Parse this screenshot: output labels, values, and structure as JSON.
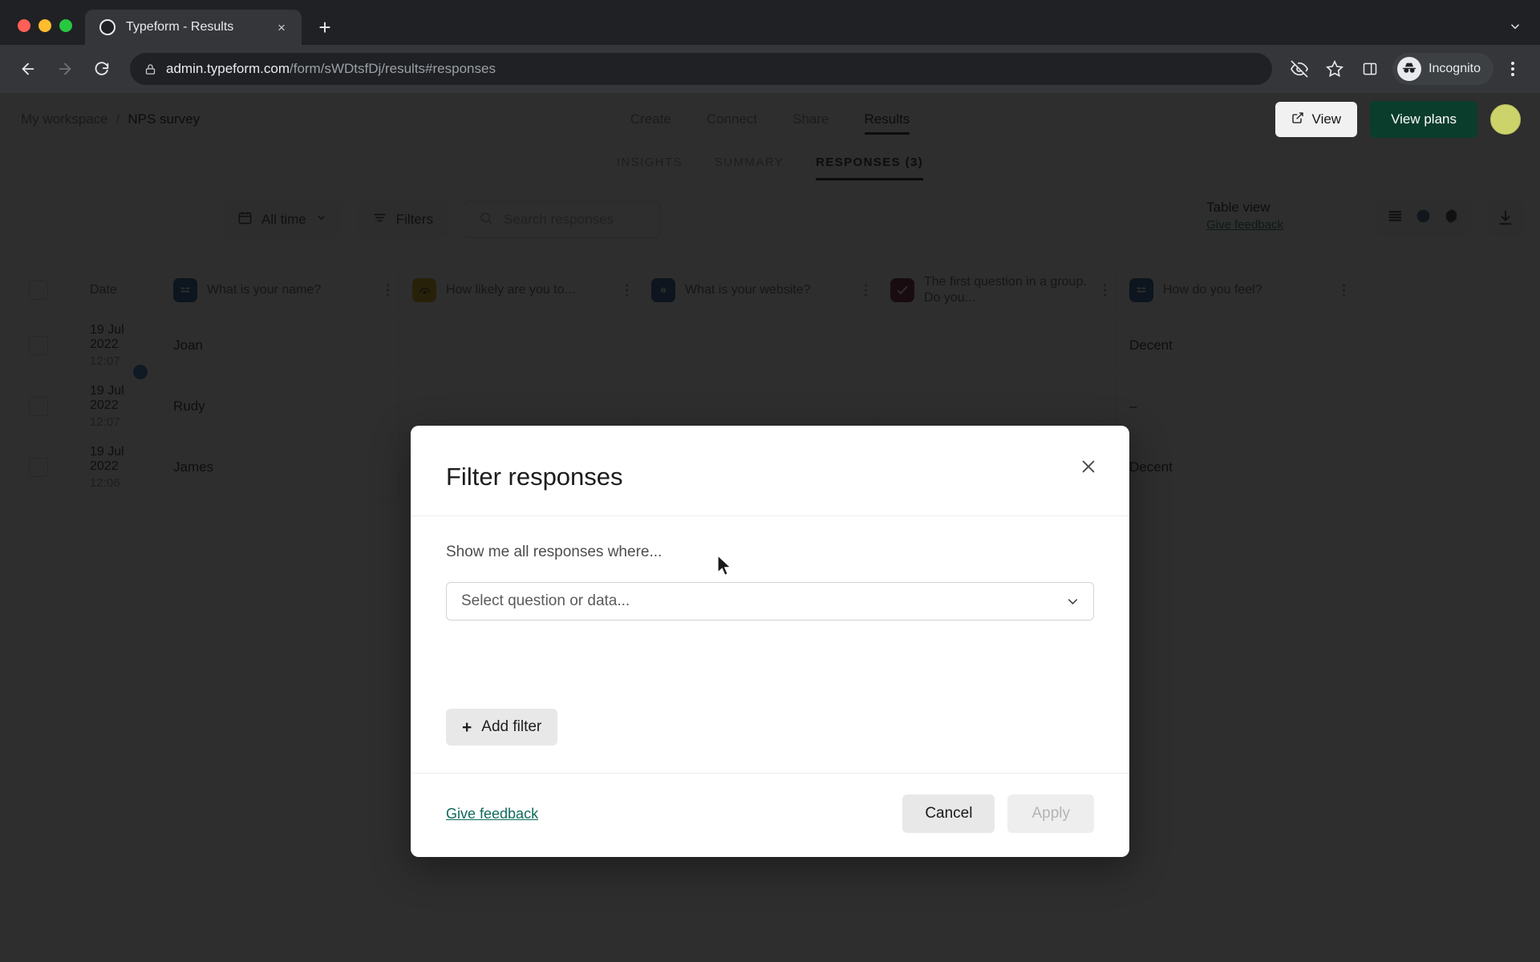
{
  "browser": {
    "tab": {
      "title": "Typeform - Results",
      "favicon": "circle-favicon",
      "close_label": "×"
    },
    "new_tab_label": "+",
    "tabstrip_chevron": "chevron-down-icon",
    "omnibox": {
      "url_domain": "admin.typeform.com",
      "url_path": "/form/sWDtsfDj/results#responses",
      "lock_icon": "lock-icon"
    },
    "profile": {
      "label": "Incognito",
      "icon": "incognito-icon"
    },
    "icons": [
      "eye-off-icon",
      "star-icon",
      "side-panel-icon",
      "three-dots-menu-icon"
    ],
    "nav": {
      "back": "back-arrow-icon",
      "forward": "forward-arrow-icon",
      "reload": "reload-icon"
    }
  },
  "page": {
    "breadcrumb": {
      "workspace": "My workspace",
      "separator": "/",
      "form": "NPS survey"
    },
    "nav_links": [
      {
        "label": "Create",
        "active": false
      },
      {
        "label": "Connect",
        "active": false
      },
      {
        "label": "Share",
        "active": false
      },
      {
        "label": "Results",
        "active": true
      }
    ],
    "view_button": "View",
    "view_plans_button": "View plans",
    "avatar": "user-avatar",
    "subtabs": [
      {
        "label": "INSIGHTS",
        "active": false
      },
      {
        "label": "SUMMARY",
        "active": false
      },
      {
        "label": "RESPONSES (3)",
        "active": true
      }
    ],
    "controls": {
      "date_filter": "All time",
      "filters_button": "Filters",
      "search_placeholder": "Search responses",
      "table_view_label": "Table view",
      "give_feedback": "Give feedback"
    },
    "table": {
      "columns": [
        {
          "label": "Date",
          "icon": null,
          "color": null
        },
        {
          "label": "What is your name?",
          "icon": "short-text-icon",
          "color": "#17508f"
        },
        {
          "label": "How likely are you to...",
          "icon": "nps-icon",
          "color": "#d2a106"
        },
        {
          "label": "What is your website?",
          "icon": "link-icon",
          "color": "#1c4f8b"
        },
        {
          "label": "The first question in a group. Do you...",
          "icon": "check-icon",
          "color": "#6b1331"
        },
        {
          "label": "How do you feel?",
          "icon": "short-text-icon",
          "color": "#17508f"
        }
      ],
      "rows": [
        {
          "date": "19 Jul 2022",
          "time": "12:07",
          "name": "Joan",
          "feel": "Decent"
        },
        {
          "date": "19 Jul 2022",
          "time": "12:07",
          "name": "Rudy",
          "feel": "–"
        },
        {
          "date": "19 Jul 2022",
          "time": "12:06",
          "name": "James",
          "feel": "Decent"
        }
      ]
    }
  },
  "modal": {
    "title": "Filter responses",
    "close_label": "×",
    "subtitle": "Show me all responses where...",
    "select_placeholder": "Select question or data...",
    "chevron": "chevron-down-icon",
    "add_filter_label": "Add filter",
    "add_filter_plus": "+",
    "give_feedback": "Give feedback",
    "cancel_label": "Cancel",
    "apply_label": "Apply"
  },
  "colors": {
    "brand_green": "#0b3d2c",
    "link_teal": "#0f6b5c",
    "overlay": "#0c0c0c"
  }
}
